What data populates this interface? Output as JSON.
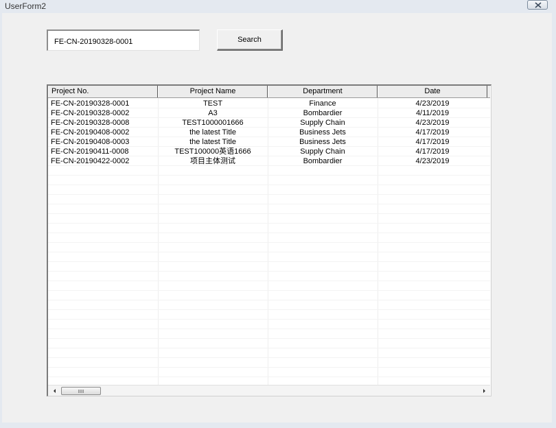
{
  "window": {
    "title": "UserForm2"
  },
  "search": {
    "value": "FE-CN-20190328-0001",
    "button_label": "Search"
  },
  "table": {
    "columns": [
      "Project No.",
      "Project Name",
      "Department",
      "Date"
    ],
    "rows": [
      [
        "FE-CN-20190328-0001",
        "TEST",
        "Finance",
        "4/23/2019"
      ],
      [
        "FE-CN-20190328-0002",
        "A3",
        "Bombardier",
        "4/11/2019"
      ],
      [
        "FE-CN-20190328-0008",
        "TEST1000001666",
        "Supply Chain",
        "4/23/2019"
      ],
      [
        "FE-CN-20190408-0002",
        "the latest Title",
        "Business Jets",
        "4/17/2019"
      ],
      [
        "FE-CN-20190408-0003",
        "the latest Title",
        "Business Jets",
        "4/17/2019"
      ],
      [
        "FE-CN-20190411-0008",
        "TEST100000英语1666",
        "Supply Chain",
        "4/17/2019"
      ],
      [
        "FE-CN-20190422-0002",
        "项目主体测试",
        "Bombardier",
        "4/23/2019"
      ]
    ]
  },
  "icons": {
    "close": "close-icon",
    "scroll_left": "arrow-left-icon",
    "scroll_right": "arrow-right-icon",
    "scroll_grip": "grip-icon"
  }
}
